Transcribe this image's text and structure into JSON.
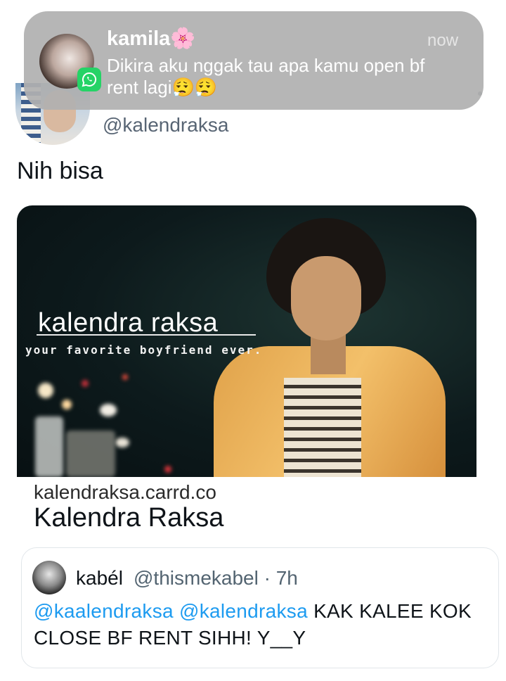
{
  "notification": {
    "sender": "kamila🌸",
    "time": "now",
    "message": "Dikira aku nggak tau apa kamu open bf rent lagi😮‍💨😮‍💨",
    "app_icon": "whatsapp-icon"
  },
  "tweet": {
    "handle": "@kalendraksa",
    "text": "Nih bisa",
    "card": {
      "image_text": "kalendra raksa",
      "image_tagline": "your favorite boyfriend ever.",
      "domain": "kalendraksa.carrd.co",
      "title": "Kalendra Raksa"
    },
    "quote": {
      "name": "kabél",
      "meta": "@thismekabel · 7h",
      "mention1": "@kaalendraksa",
      "mention2": "@kalendraksa",
      "text": "KAK KALEE KOK CLOSE BF RENT SIHH! Y__Y"
    }
  },
  "colors": {
    "link": "#1d9bf0",
    "secondary_text": "#536471",
    "notification_bg": "#b0b0b0",
    "whatsapp": "#25d366"
  }
}
